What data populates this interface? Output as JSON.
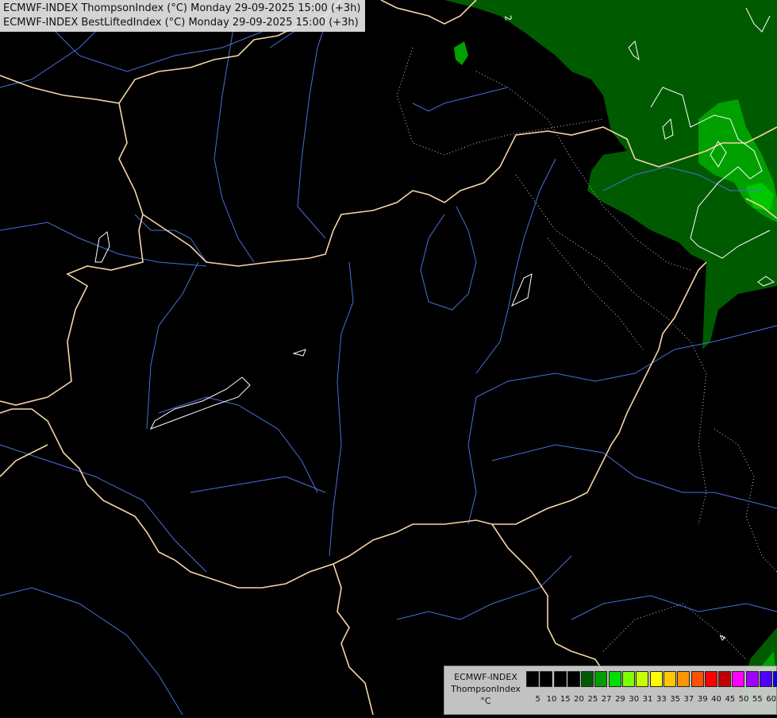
{
  "title": {
    "line1": "ECMWF-INDEX ThompsonIndex (°C) Monday 29-09-2025 15:00 (+3h)",
    "line2": "ECMWF-INDEX BestLiftedIndex (°C) Monday 29-09-2025 15:00 (+3h)"
  },
  "legend": {
    "model": "ECMWF-INDEX",
    "parameter": "ThompsonIndex",
    "unit": "°C",
    "ticks": [
      "5",
      "10",
      "15",
      "20",
      "25",
      "27",
      "29",
      "30",
      "31",
      "33",
      "35",
      "37",
      "39",
      "40",
      "45",
      "50",
      "55",
      "60"
    ],
    "colors": [
      "#000000",
      "#000000",
      "#000000",
      "#000000",
      "#005b00",
      "#00a000",
      "#00e000",
      "#80ff00",
      "#c8ff00",
      "#ffff00",
      "#ffc800",
      "#ff9600",
      "#ff5000",
      "#ff0000",
      "#c00000",
      "#ff00ff",
      "#a000ff",
      "#5000ff",
      "#0000ff"
    ]
  },
  "map_labels": {
    "contour_top": "2",
    "contour_bottom": "4"
  },
  "colors": {
    "background": "#000000",
    "field_dark_green": "#005b00",
    "field_green": "#00a000",
    "borders": "#f5d5a8",
    "rivers": "#4a6fd8",
    "contours_white": "#ffffff"
  }
}
